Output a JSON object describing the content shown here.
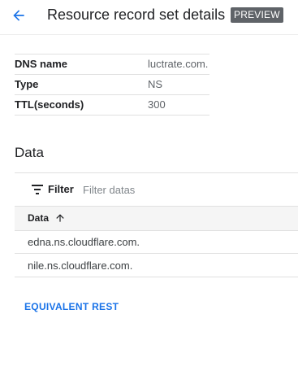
{
  "header": {
    "title": "Resource record set details",
    "badge": "PREVIEW",
    "back_icon": "arrow-back-icon"
  },
  "details": [
    {
      "key": "DNS name",
      "value": "luctrate.com."
    },
    {
      "key": "Type",
      "value": "NS"
    },
    {
      "key": "TTL(seconds)",
      "value": "300"
    }
  ],
  "data_section": {
    "title": "Data",
    "filter_label": "Filter",
    "filter_placeholder": "Filter datas",
    "filter_icon": "filter-list-icon",
    "column_header": "Data",
    "sort_icon": "arrow-up-icon",
    "rows": [
      "edna.ns.cloudflare.com.",
      "nile.ns.cloudflare.com."
    ]
  },
  "footer": {
    "equivalent_rest": "EQUIVALENT REST"
  },
  "colors": {
    "accent": "#1a73e8",
    "badge_bg": "#5f6368"
  }
}
